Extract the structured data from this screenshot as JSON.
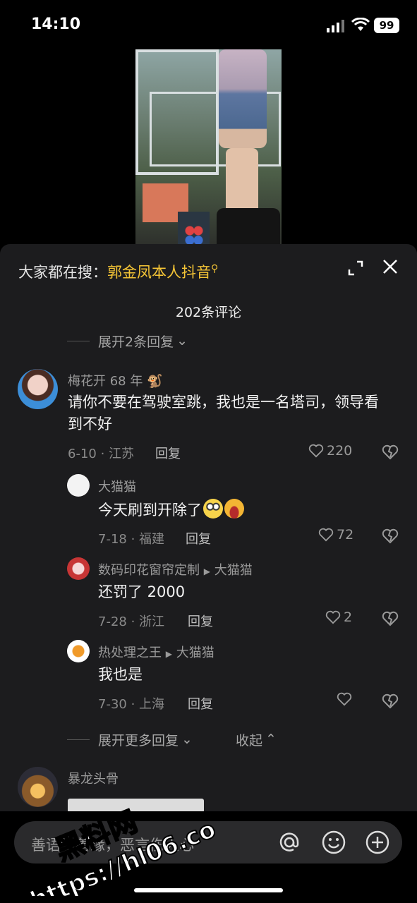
{
  "status": {
    "time": "14:10",
    "battery": "99"
  },
  "search": {
    "prefix": "大家都在搜：",
    "keyword": "郭金凤本人抖音"
  },
  "comments_header": {
    "count_label": "202条评论"
  },
  "expand_top": "展开2条回复",
  "comment": {
    "username": "梅花开 68 年",
    "text": "请你不要在驾驶室跳，我也是一名塔司，领导看到不好",
    "date_location": "6-10 · 江苏",
    "reply_label": "回复",
    "likes": "220"
  },
  "replies": [
    {
      "username": "大猫猫",
      "reply_to": "",
      "text": "今天刷到开除了",
      "date_location": "7-18 · 福建",
      "reply_label": "回复",
      "likes": "72"
    },
    {
      "username": "数码印花窗帘定制",
      "reply_to": "大猫猫",
      "text": "还罚了 2000",
      "date_location": "7-28 · 浙江",
      "reply_label": "回复",
      "likes": "2"
    },
    {
      "username": "热处理之王",
      "reply_to": "大猫猫",
      "text": "我也是",
      "date_location": "7-30 · 上海",
      "reply_label": "回复",
      "likes": ""
    }
  ],
  "expand_more": "展开更多回复",
  "collapse": "收起",
  "next_comment": {
    "username": "暴龙头骨"
  },
  "input": {
    "placeholder": "善语结善缘，恶言伤人心"
  },
  "watermark": {
    "line1": "黑料网",
    "line2": "https://hl06.co"
  },
  "colors": {
    "keyword": "#f5c536",
    "sheet": "#1c1c1e"
  }
}
